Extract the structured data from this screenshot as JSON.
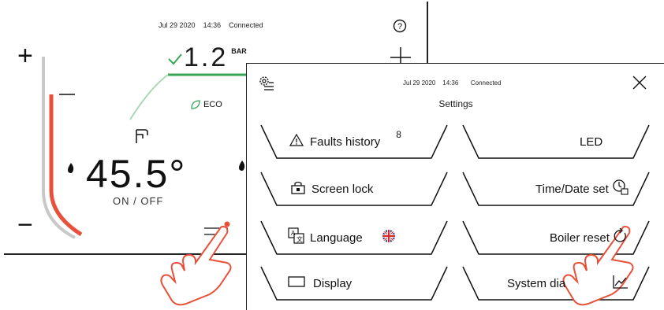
{
  "main": {
    "date": "Jul 29 2020",
    "time": "14:36",
    "connection": "Connected",
    "help_icon": "question-circle-icon",
    "plus_left": "+",
    "minus_left": "−",
    "pressure_value": "1.2",
    "pressure_unit": "BAR",
    "eco_label": "ECO",
    "temperature": "45.5°",
    "power_toggle": "ON / OFF",
    "colors": {
      "accent_red": "#e8503a",
      "accent_green": "#3aa655"
    }
  },
  "settings": {
    "header_date": "Jul 29 2020",
    "header_time": "14:36",
    "header_status": "Connected",
    "title": "Settings",
    "items": [
      {
        "label": "Faults history",
        "badge": "8",
        "icon": "warning-triangle-icon"
      },
      {
        "label": "LED",
        "icon": ""
      },
      {
        "label": "Screen lock",
        "icon": "lock-icon"
      },
      {
        "label": "Time/Date set",
        "icon": "clock-calendar-icon"
      },
      {
        "label": "Language",
        "icon": "translate-icon",
        "flag": "uk-flag-icon"
      },
      {
        "label": "Boiler reset",
        "icon": "reset-arrow-icon"
      },
      {
        "label": "Display",
        "icon": "display-rectangle-icon"
      },
      {
        "label": "System dia",
        "icon": "chart-line-icon"
      }
    ]
  }
}
